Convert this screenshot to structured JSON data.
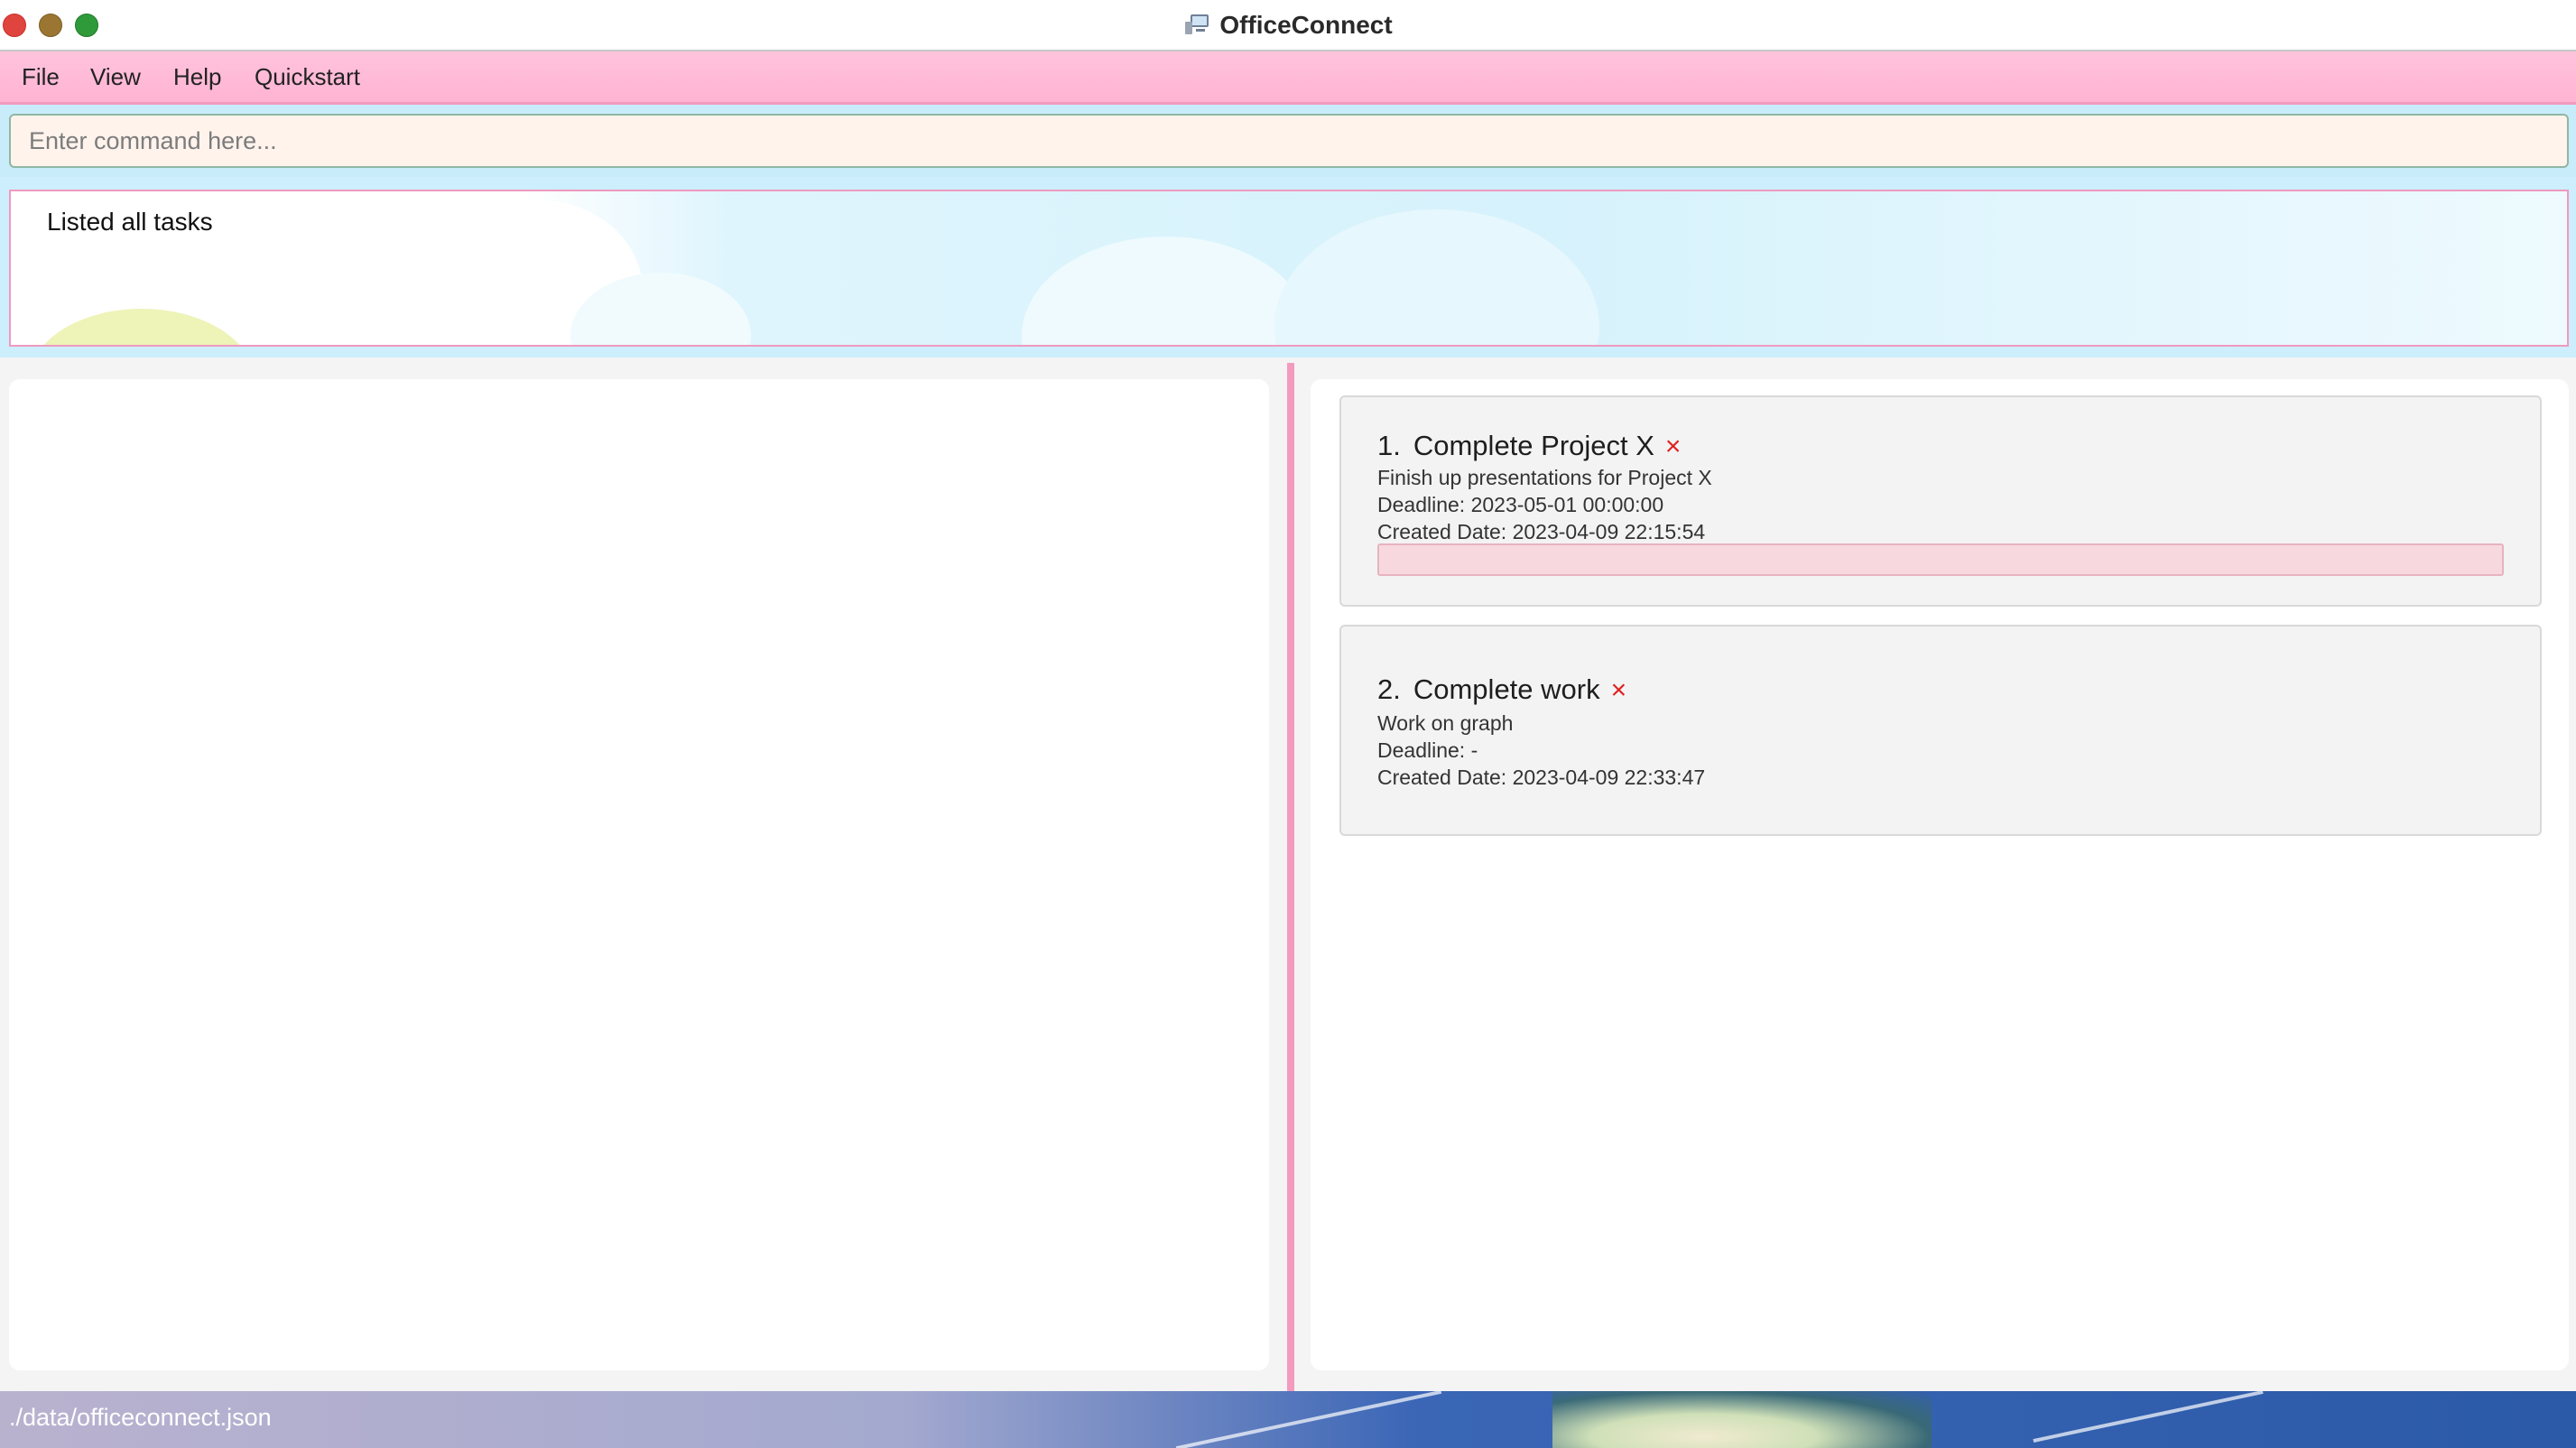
{
  "window": {
    "title": "OfficeConnect",
    "app_icon": "computer-icon"
  },
  "menu": {
    "items": [
      "File",
      "View",
      "Help",
      "Quickstart"
    ]
  },
  "command": {
    "placeholder": "Enter command here...",
    "value": ""
  },
  "result": {
    "message": "Listed all tasks"
  },
  "tasks": [
    {
      "index": "1.",
      "title": "Complete Project X",
      "status_mark": "×",
      "description": "Finish up presentations for Project X",
      "deadline": "Deadline: 2023-05-01 00:00:00",
      "created": "Created Date: 2023-04-09 22:15:54",
      "has_progress_bar": true,
      "progress_fraction": 0
    },
    {
      "index": "2.",
      "title": "Complete work",
      "status_mark": "×",
      "description": "Work on graph",
      "deadline": "Deadline: -",
      "created": "Created Date: 2023-04-09 22:33:47",
      "has_progress_bar": false
    }
  ],
  "status_bar": {
    "path": "./data/officeconnect.json"
  },
  "colors": {
    "menu_bg": "#ffb8d6",
    "accent_pink": "#f29bbf",
    "command_bg": "#fff3ec",
    "status_mark": "#e02020"
  }
}
